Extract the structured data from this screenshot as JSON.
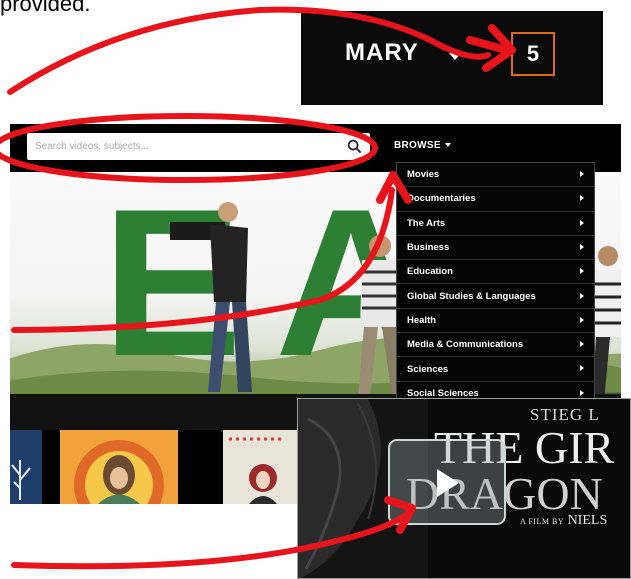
{
  "caption_fragment": "provided.",
  "account": {
    "user_name": "MARY",
    "count": "5"
  },
  "toolbar": {
    "search_placeholder": "Search videos, subjects...",
    "browse_label": "BROWSE"
  },
  "hero": {
    "letter_1": "E",
    "letter_2": "A"
  },
  "browse_menu": {
    "items": [
      "Movies",
      "Documentaries",
      "The Arts",
      "Business",
      "Education",
      "Global Studies & Languages",
      "Health",
      "Media & Communications",
      "Sciences",
      "Social Sciences"
    ]
  },
  "video": {
    "author": "STIEG L",
    "title_line_1": "THE GIR",
    "title_line_2": "DRAGON",
    "credit_prefix": "A FILM BY",
    "credit_name": "NIELS"
  },
  "colors": {
    "annotation_red": "#e8141c",
    "badge_orange": "#e06a1c",
    "hero_green": "#2c7f33"
  }
}
